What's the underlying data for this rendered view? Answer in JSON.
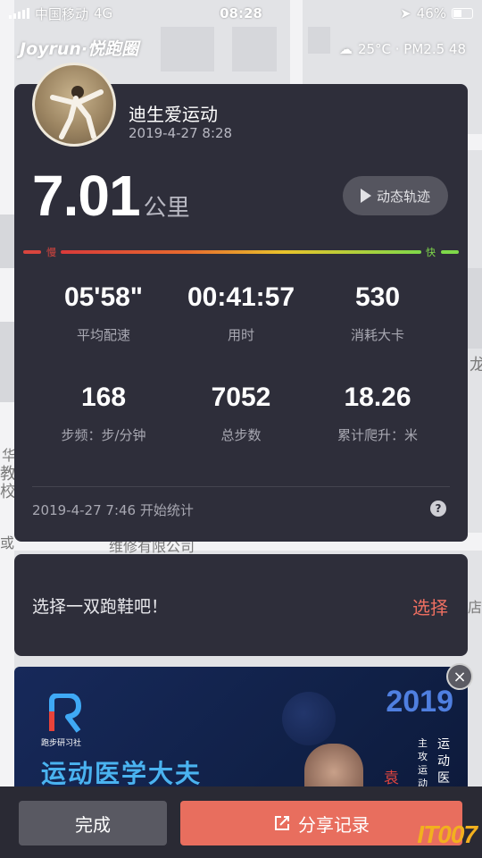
{
  "status_bar": {
    "carrier": "中国移动",
    "network": "4G",
    "time": "08:28",
    "battery": "46%"
  },
  "header": {
    "brand": "Joyrun·悦跑圈",
    "weather": "25°C · PM2.5 48"
  },
  "map": {
    "labels": [
      "维修有限公司",
      "龙",
      "店",
      "教",
      "校",
      "华",
      "或"
    ]
  },
  "run": {
    "user_name": "迪生爱运动",
    "date": "2019-4-27 8:28",
    "distance": "7.01",
    "distance_unit": "公里",
    "replay_label": "动态轨迹",
    "pace_slow_label": "慢",
    "pace_fast_label": "快",
    "stats": [
      {
        "value": "05'58\"",
        "label": "平均配速"
      },
      {
        "value": "00:41:57",
        "label": "用时"
      },
      {
        "value": "530",
        "label": "消耗大卡"
      },
      {
        "value": "168",
        "label": "步频：步/分钟"
      },
      {
        "value": "7052",
        "label": "总步数"
      },
      {
        "value": "18.26",
        "label": "累计爬升：米"
      }
    ],
    "start_text": "2019-4-27 7:46 开始统计",
    "help": "?"
  },
  "shoe": {
    "prompt": "选择一双跑鞋吧！",
    "select_label": "选择"
  },
  "ad": {
    "logo_text": "跑步研习社",
    "title": "运动医学大夫",
    "year": "2019",
    "vert_a": "主攻运动",
    "vert_b": "运动医",
    "name": "袁",
    "close": "×"
  },
  "bottom": {
    "done_label": "完成",
    "share_label": "分享记录"
  },
  "watermark": "IT007",
  "colors": {
    "card_bg": "#2e2e3a",
    "accent": "#e86e5e",
    "slow": "#d9453e",
    "fast": "#7fd94a"
  }
}
